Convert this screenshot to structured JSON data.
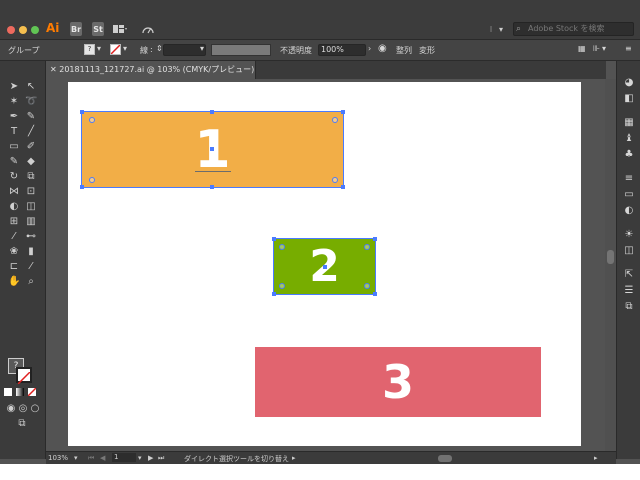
{
  "app": {
    "name": "Ai",
    "colors": {
      "brand": "#ff7c00",
      "selection": "#4a7bff"
    }
  },
  "titlebar": {
    "buttons": [
      {
        "label": "Br",
        "icon": "bridge-icon"
      },
      {
        "label": "St",
        "icon": "stock-icon"
      },
      {
        "label": "",
        "icon": "workspace-layout-icon"
      },
      {
        "label": "",
        "icon": "gpu-performance-icon"
      }
    ],
    "workspace_menu": "⁝",
    "stock_search_placeholder": "Adobe Stock を検索"
  },
  "control_bar": {
    "selection_label": "グループ",
    "fill_indicator": "?",
    "stroke_label": "線",
    "opacity_label": "不透明度",
    "opacity_value": "100%",
    "arrange_label": "整列",
    "transform_label": "変形"
  },
  "document_tab": {
    "title": "20181113_121727.ai @ 103% (CMYK/プレビュー)",
    "close": "✕"
  },
  "canvas": {
    "shapes": [
      {
        "label": "1",
        "color": "#f2ae47",
        "selected": true
      },
      {
        "label": "2",
        "color": "#77ad00",
        "selected": true
      },
      {
        "label": "3",
        "color": "#e1646f",
        "selected": false
      }
    ]
  },
  "status_bar": {
    "zoom": "103%",
    "artboard_number": "1",
    "tool_status": "ダイレクト選択ツールを切り替え"
  },
  "toolbar": {
    "fill_glyph": "?"
  }
}
